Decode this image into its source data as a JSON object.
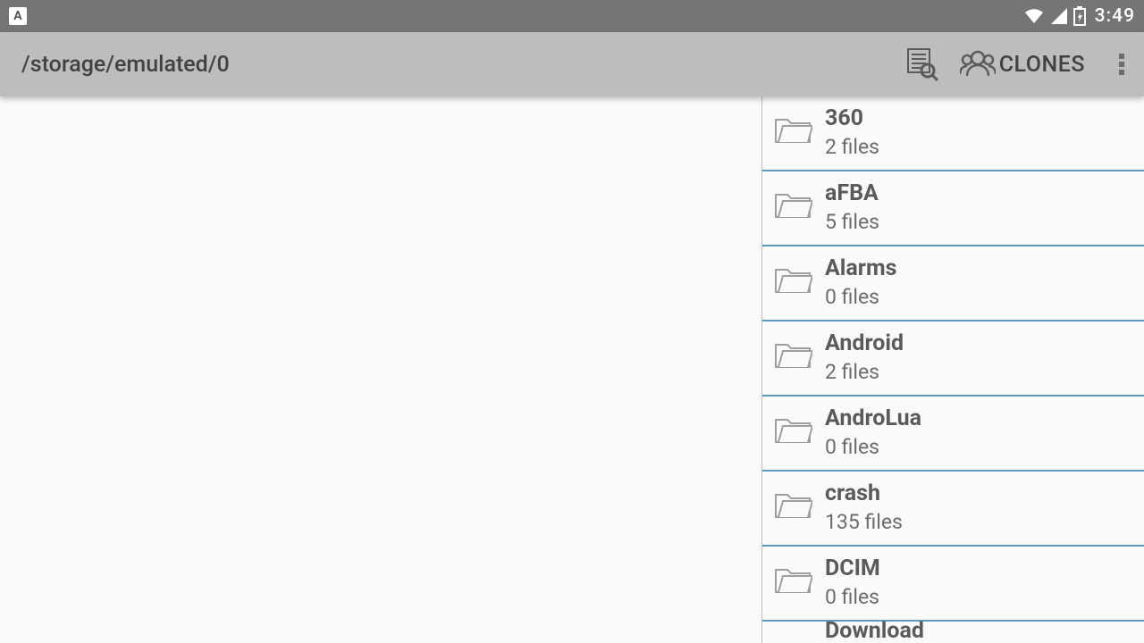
{
  "status": {
    "app_icon_letter": "A",
    "time": "3:49"
  },
  "toolbar": {
    "path": "/storage/emulated/0",
    "clones_label": "CLONES"
  },
  "folders": [
    {
      "name": "360",
      "sub": "2 files"
    },
    {
      "name": "aFBA",
      "sub": "5 files"
    },
    {
      "name": "Alarms",
      "sub": "0 files"
    },
    {
      "name": "Android",
      "sub": "2 files"
    },
    {
      "name": "AndroLua",
      "sub": "0 files"
    },
    {
      "name": "crash",
      "sub": "135 files"
    },
    {
      "name": "DCIM",
      "sub": "0 files"
    }
  ],
  "partial_folder_name": "Download"
}
